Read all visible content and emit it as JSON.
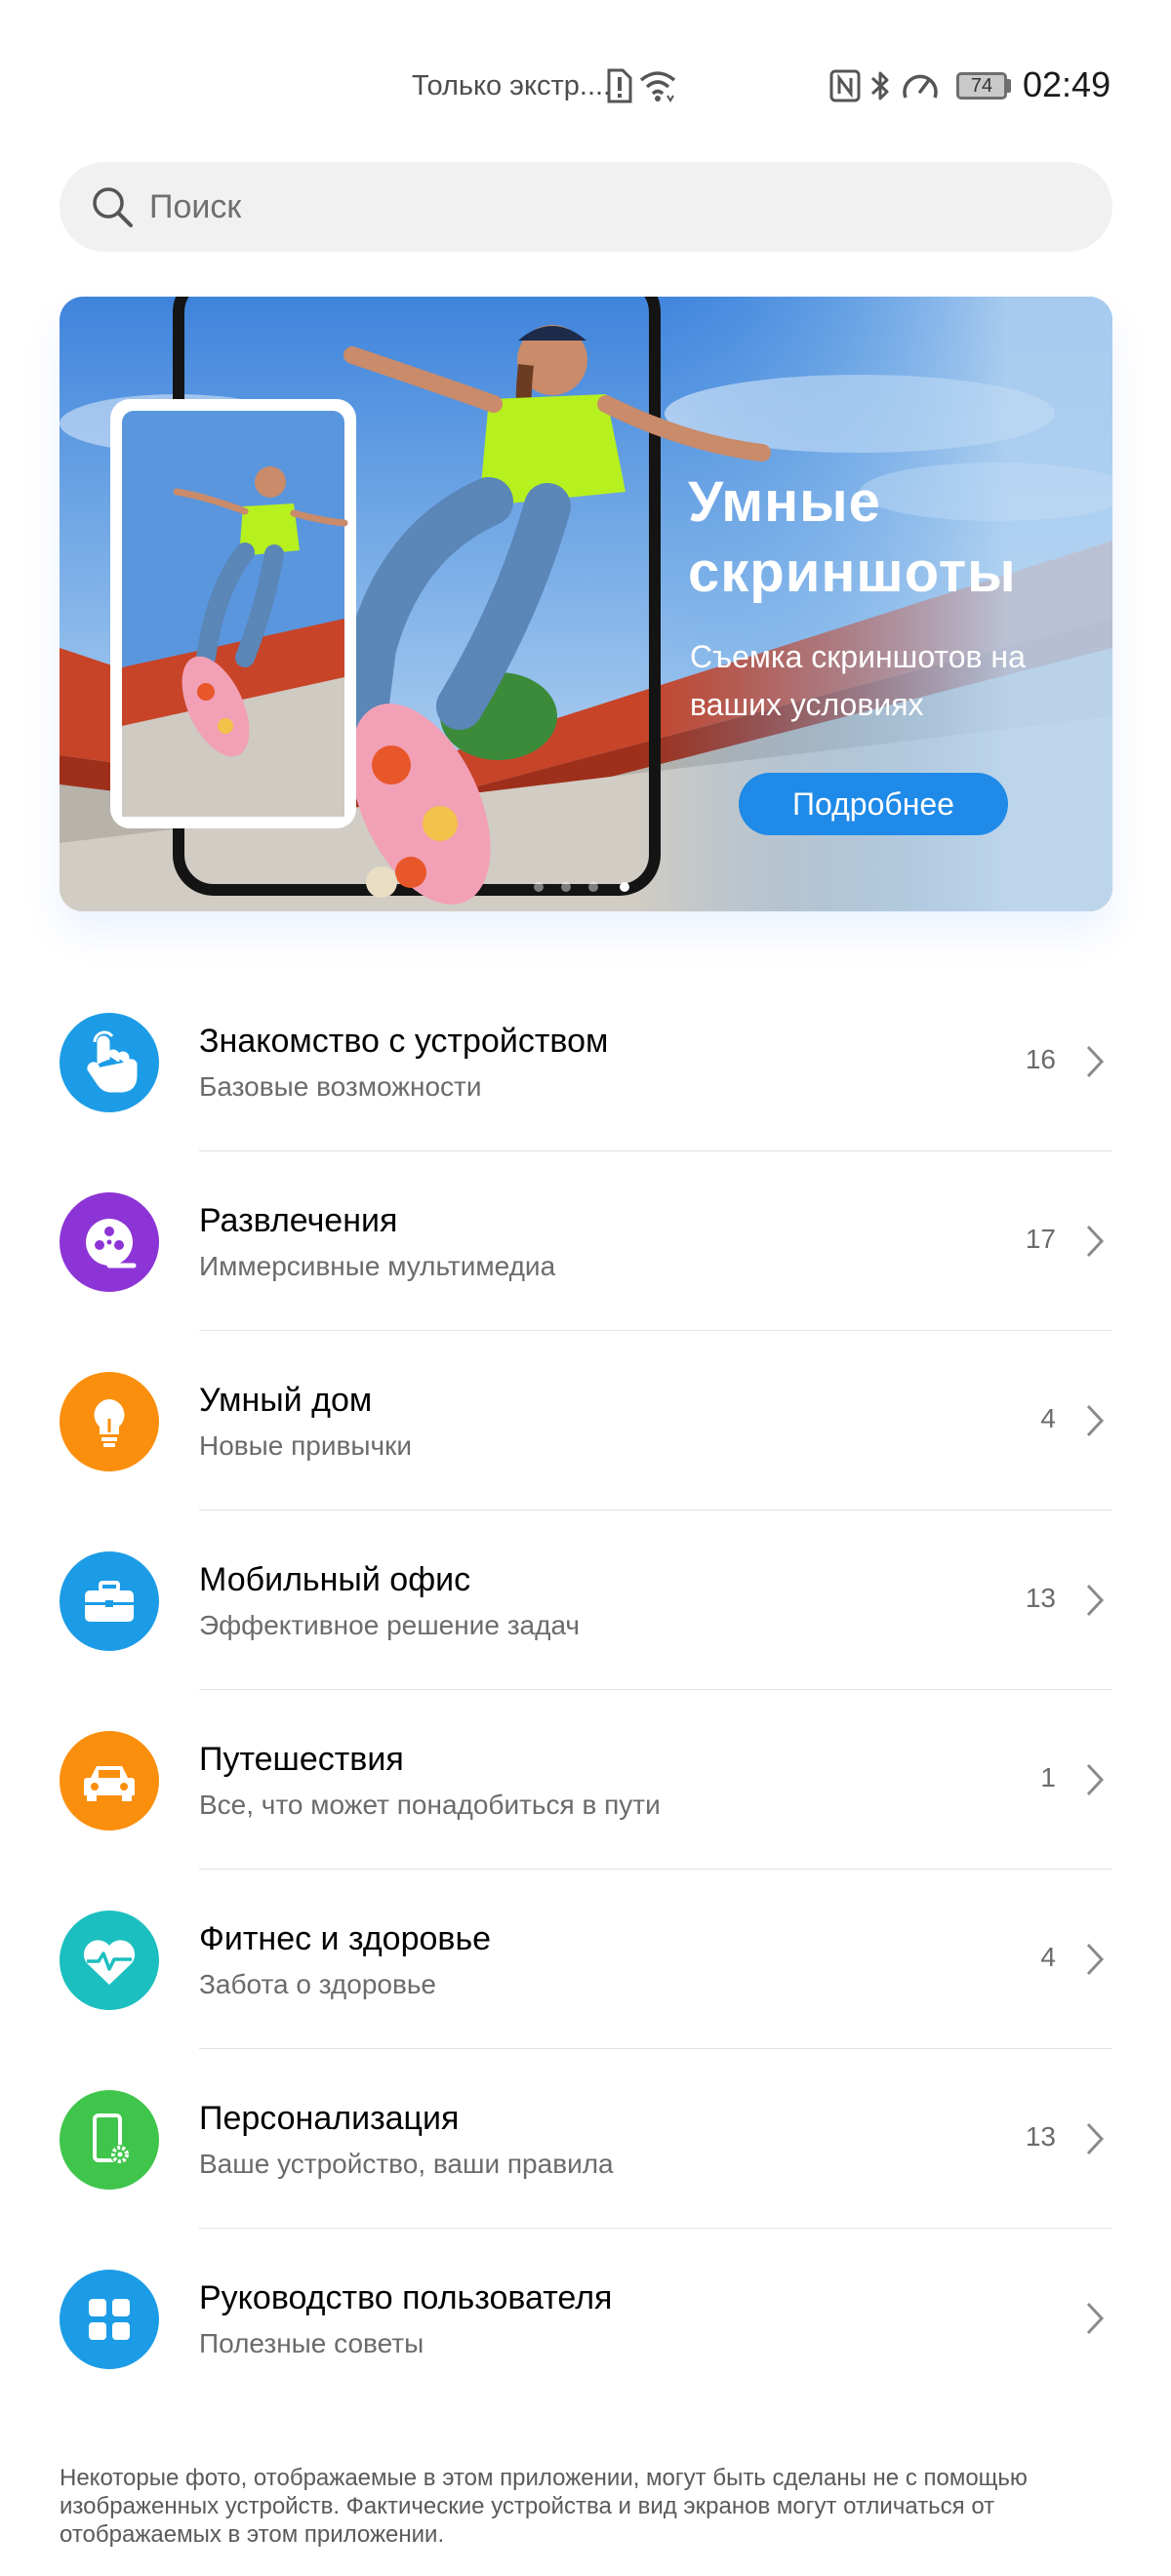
{
  "status_bar": {
    "carrier": "Только экстр....",
    "battery": "74",
    "time": "02:49",
    "icons": [
      "alert-sim-icon",
      "wifi-icon",
      "nfc-icon",
      "bluetooth-icon",
      "data-saver-icon",
      "battery-icon"
    ]
  },
  "search": {
    "placeholder": "Поиск",
    "icon": "search-icon"
  },
  "banner": {
    "title": "Умные скриншоты",
    "subtitle": "Съемка скриншотов на ваших условиях",
    "button_label": "Подробнее",
    "pages": 4,
    "active_page": 4
  },
  "categories": [
    {
      "title": "Знакомство с устройством",
      "subtitle": "Базовые возможности",
      "count": "16",
      "icon": "touch-hand-icon",
      "color": "#1c9ce6"
    },
    {
      "title": "Развлечения",
      "subtitle": "Иммерсивные мультимедиа",
      "count": "17",
      "icon": "film-reel-icon",
      "color": "#8d34d6"
    },
    {
      "title": "Умный дом",
      "subtitle": "Новые привычки",
      "count": "4",
      "icon": "light-bulb-icon",
      "color": "#fa8f0d"
    },
    {
      "title": "Мобильный офис",
      "subtitle": "Эффективное решение задач",
      "count": "13",
      "icon": "briefcase-icon",
      "color": "#1c9ce6"
    },
    {
      "title": "Путешествия",
      "subtitle": "Все, что может понадобиться в пути",
      "count": "1",
      "icon": "car-icon",
      "color": "#fa8f0d"
    },
    {
      "title": "Фитнес и здоровье",
      "subtitle": "Забота о здоровье",
      "count": "4",
      "icon": "heart-pulse-icon",
      "color": "#1cbfbf"
    },
    {
      "title": "Персонализация",
      "subtitle": "Ваше устройство, ваши правила",
      "count": "13",
      "icon": "phone-settings-icon",
      "color": "#3fc54b"
    },
    {
      "title": "Руководство пользователя",
      "subtitle": "Полезные советы",
      "count": "",
      "icon": "grid-apps-icon",
      "color": "#1c9ce6"
    }
  ],
  "footer": {
    "note": "Некоторые фото, отображаемые в этом приложении, могут быть сделаны не с помощью изображенных устройств. Фактические устройства и вид экранов могут отличаться от отображаемых в этом приложении."
  }
}
